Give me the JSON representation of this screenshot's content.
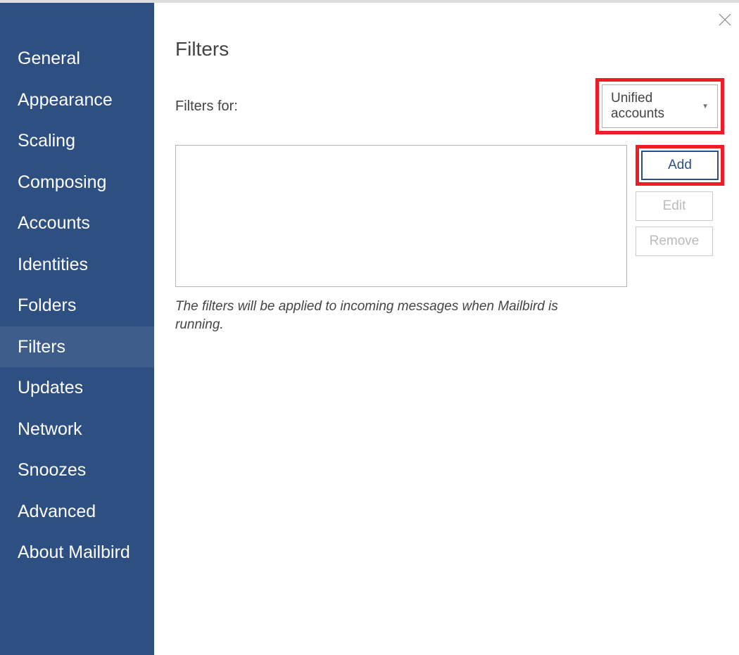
{
  "sidebar": {
    "items": [
      {
        "label": "General",
        "active": false
      },
      {
        "label": "Appearance",
        "active": false
      },
      {
        "label": "Scaling",
        "active": false
      },
      {
        "label": "Composing",
        "active": false
      },
      {
        "label": "Accounts",
        "active": false
      },
      {
        "label": "Identities",
        "active": false
      },
      {
        "label": "Folders",
        "active": false
      },
      {
        "label": "Filters",
        "active": true
      },
      {
        "label": "Updates",
        "active": false
      },
      {
        "label": "Network",
        "active": false
      },
      {
        "label": "Snoozes",
        "active": false
      },
      {
        "label": "Advanced",
        "active": false
      },
      {
        "label": "About Mailbird",
        "active": false
      }
    ]
  },
  "main": {
    "title": "Filters",
    "filters_for_label": "Filters for:",
    "dropdown_selected": "Unified accounts",
    "buttons": {
      "add": "Add",
      "edit": "Edit",
      "remove": "Remove"
    },
    "hint": "The filters will be applied to incoming messages when Mailbird is running."
  },
  "highlights": {
    "dropdown": true,
    "add_button": true
  }
}
